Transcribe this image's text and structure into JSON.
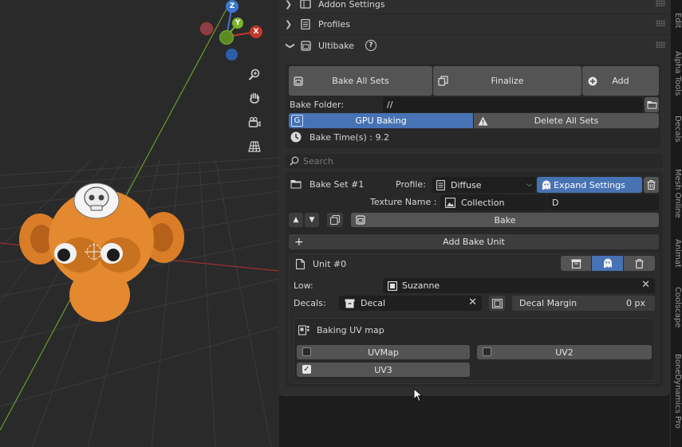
{
  "viewport": {
    "gizmo": {
      "z": "Z",
      "y": "Y",
      "x": "X"
    },
    "colors": {
      "background": "#2a2a2a",
      "x_axis": "#c0392b",
      "y_axis": "#7ab32c",
      "z_axis": "#3a77cf",
      "monkey": "#e4892f"
    },
    "tools": [
      "zoom-icon",
      "hand-pan-icon",
      "camera-icon",
      "grid-perspective-icon"
    ]
  },
  "panel": {
    "sections": {
      "addon_settings": "Addon Settings",
      "profiles": "Profiles",
      "ultibake": "Ultibake"
    },
    "help_label": "?",
    "toolbar": {
      "bake_all_sets": "Bake All Sets",
      "finalize": "Finalize",
      "add": "Add"
    },
    "bake_folder_label": "Bake Folder:",
    "bake_folder_value": "//",
    "gpu_baking_key": "G",
    "gpu_baking": "GPU Baking",
    "delete_all_sets": "Delete All Sets",
    "bake_time": "Bake Time(s) : 9.2",
    "search_placeholder": "Search",
    "bake_set": {
      "title": "Bake Set #1",
      "profile_label": "Profile:",
      "profile_value": "Diffuse",
      "expand_settings": "Expand Settings",
      "texture_name_label": "Texture Name :",
      "texture_collection": "Collection",
      "texture_name_value": "D",
      "bake_button": "Bake",
      "add_bake_unit": "Add Bake Unit"
    },
    "unit": {
      "title": "Unit #0",
      "low_label": "Low:",
      "low_value": "Suzanne",
      "decals_label": "Decals:",
      "decals_value": "Decal",
      "decal_margin_label": "Decal Margin",
      "decal_margin_value": "0 px",
      "uv_map_title": "Baking UV map",
      "uv_maps": [
        {
          "label": "UVMap",
          "checked": false
        },
        {
          "label": "UV2",
          "checked": false
        },
        {
          "label": "UV3",
          "checked": true
        }
      ]
    }
  },
  "side_tabs": [
    "Edit",
    "Alpha Tools",
    "Decals",
    "Mesh Online",
    "Animat",
    "Coolscape",
    "BoneDynamics Pro"
  ]
}
